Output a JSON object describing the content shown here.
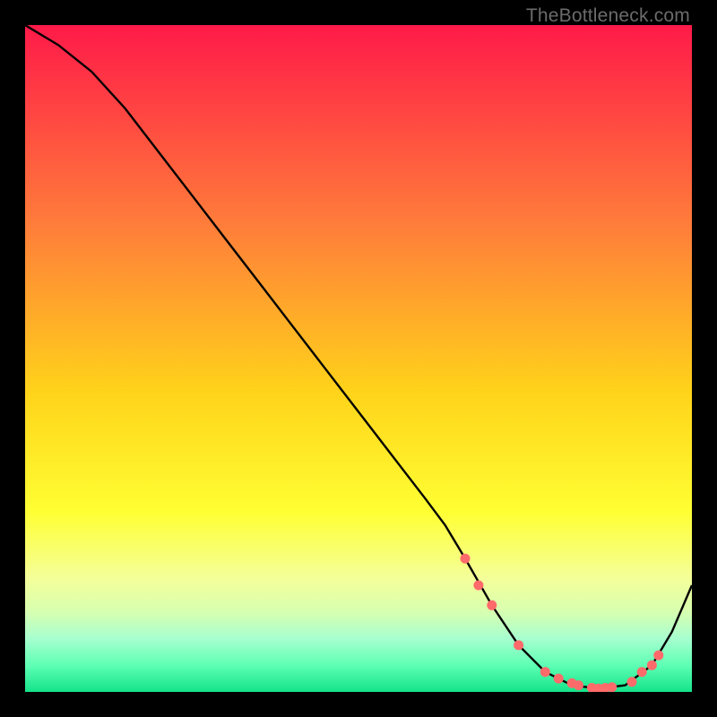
{
  "watermark": "TheBottleneck.com",
  "colors": {
    "grad_top": "#ff1a49",
    "grad_mid1": "#ff7d3a",
    "grad_mid2": "#ffd31a",
    "grad_mid3": "#ffff33",
    "grad_band1": "#f4ff9a",
    "grad_band2": "#d7ffb0",
    "grad_band3": "#a7ffcf",
    "grad_band4": "#5effb4",
    "grad_bottom": "#14e38a",
    "curve": "#000000",
    "dot": "#ff6b6b"
  },
  "chart_data": {
    "type": "line",
    "title": "",
    "xlabel": "",
    "ylabel": "",
    "xlim": [
      0,
      100
    ],
    "ylim": [
      0,
      100
    ],
    "series": [
      {
        "name": "bottleneck-curve",
        "x": [
          0,
          5,
          10,
          15,
          20,
          25,
          30,
          35,
          40,
          45,
          50,
          55,
          60,
          63,
          66,
          70,
          74,
          78,
          82,
          86,
          90,
          94,
          97,
          100
        ],
        "values": [
          100,
          97,
          93,
          87.5,
          81,
          74.5,
          68,
          61.5,
          55,
          48.5,
          42,
          35.5,
          29,
          25,
          20,
          13,
          7,
          3,
          1,
          0.5,
          1,
          4,
          9,
          16
        ]
      }
    ],
    "dots": [
      {
        "x": 66,
        "y": 20
      },
      {
        "x": 68,
        "y": 16
      },
      {
        "x": 70,
        "y": 13
      },
      {
        "x": 74,
        "y": 7
      },
      {
        "x": 78,
        "y": 3
      },
      {
        "x": 80,
        "y": 2
      },
      {
        "x": 82,
        "y": 1.3
      },
      {
        "x": 83,
        "y": 1
      },
      {
        "x": 85,
        "y": 0.6
      },
      {
        "x": 86,
        "y": 0.5
      },
      {
        "x": 87,
        "y": 0.6
      },
      {
        "x": 88,
        "y": 0.7
      },
      {
        "x": 91,
        "y": 1.5
      },
      {
        "x": 92.5,
        "y": 3
      },
      {
        "x": 94,
        "y": 4
      },
      {
        "x": 95,
        "y": 5.5
      }
    ],
    "gradient_stops": [
      {
        "offset": 0,
        "key": "grad_top"
      },
      {
        "offset": 0.3,
        "key": "grad_mid1"
      },
      {
        "offset": 0.55,
        "key": "grad_mid2"
      },
      {
        "offset": 0.73,
        "key": "grad_mid3"
      },
      {
        "offset": 0.83,
        "key": "grad_band1"
      },
      {
        "offset": 0.88,
        "key": "grad_band2"
      },
      {
        "offset": 0.92,
        "key": "grad_band3"
      },
      {
        "offset": 0.96,
        "key": "grad_band4"
      },
      {
        "offset": 1.0,
        "key": "grad_bottom"
      }
    ]
  }
}
